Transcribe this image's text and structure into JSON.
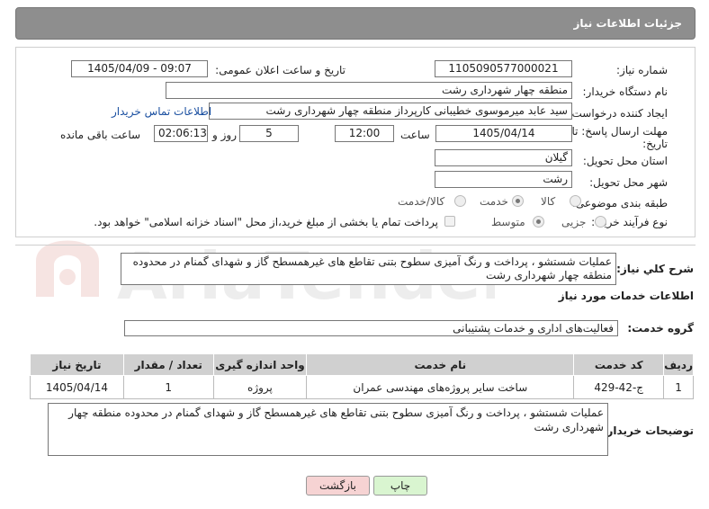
{
  "header": {
    "title": "جزئیات اطلاعات نیاز"
  },
  "fields": {
    "need_number_label": "شماره نیاز:",
    "need_number": "1105090577000021",
    "announce_label": "تاریخ و ساعت اعلان عمومی:",
    "announce_value": "1405/04/09 - 09:07",
    "buyer_org_label": "نام دستگاه خریدار:",
    "buyer_org": "منطقه چهار شهرداری رشت",
    "creator_label": "ایجاد کننده درخواست:",
    "creator": "سید عابد میرموسوی خطیبانی کارپرداز منطقه چهار شهرداری رشت",
    "contact_link": "اطلاعات تماس خریدار",
    "deadline_label_1": "مهلت ارسال پاسخ: تا",
    "deadline_label_2": "تاریخ:",
    "deadline_date": "1405/04/14",
    "time_label": "ساعت",
    "deadline_time": "12:00",
    "days_value": "5",
    "days_label": "روز و",
    "remaining_time": "02:06:13",
    "remaining_label": "ساعت باقی مانده",
    "province_label": "استان محل تحویل:",
    "province": "گیلان",
    "city_label": "شهر محل تحویل:",
    "city": "رشت",
    "category_label": "طبقه بندی موضوعی:",
    "category_options": [
      "کالا",
      "خدمت",
      "کالا/خدمت"
    ],
    "category_selected": "خدمت",
    "process_label": "نوع فرآیند خرید :",
    "process_options": [
      "جزیی",
      "متوسط"
    ],
    "process_selected": "متوسط",
    "treasury_note": "پرداخت تمام یا بخشی از مبلغ خرید،از محل \"اسناد خزانه اسلامی\" خواهد بود."
  },
  "summary": {
    "label": "شرح كلي نياز:",
    "text": "عملیات شستشو ، پرداخت و رنگ آمیزی سطوح بتنی تقاطع های غیرهمسطح گاز و شهدای گمنام در محدوده منطقه چهار شهرداری رشت"
  },
  "services": {
    "section_title": "اطلاعات خدمات مورد نیاز",
    "group_label": "گروه خدمت:",
    "group_value": "فعالیت‌های اداری و خدمات پشتیبانی",
    "columns": [
      "ردیف",
      "کد خدمت",
      "نام خدمت",
      "واحد اندازه گیری",
      "تعداد / مقدار",
      "تاریخ نیاز"
    ],
    "rows": [
      {
        "row": "1",
        "code": "ج-42-429",
        "name": "ساخت سایر پروژه‌های مهندسی عمران",
        "unit": "پروژه",
        "qty": "1",
        "date": "1405/04/14"
      }
    ]
  },
  "buyer_notes": {
    "label": "توضیحات خریدار:",
    "text": "عملیات شستشو ، پرداخت و رنگ آمیزی سطوح بتنی تقاطع های غیرهمسطح گاز و شهدای گمنام در محدوده منطقه چهار شهرداری رشت"
  },
  "buttons": {
    "print": "چاپ",
    "back": "بازگشت"
  },
  "watermark": "AriaTender.net",
  "colors": {
    "header_bg": "#8e8e8e",
    "link": "#1a4fa0",
    "print_btn": "#d9f5d0",
    "back_btn": "#f6d3d3"
  }
}
